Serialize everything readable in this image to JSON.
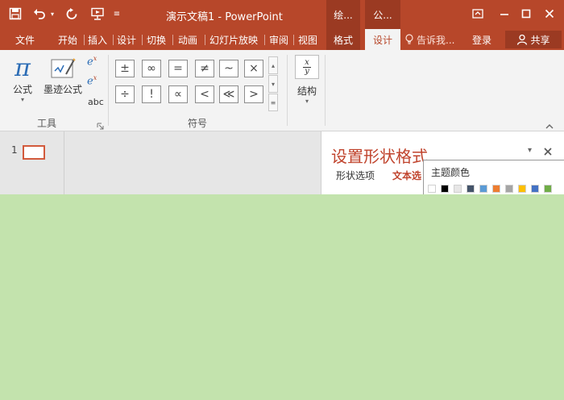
{
  "titlebar": {
    "doc_title": "演示文稿1 - PowerPoint",
    "context_tab_1": "绘...",
    "context_tab_2": "公..."
  },
  "tabs": [
    {
      "label": "文件"
    },
    {
      "label": "开始"
    },
    {
      "label": "插入"
    },
    {
      "label": "设计"
    },
    {
      "label": "切换"
    },
    {
      "label": "动画"
    },
    {
      "label": "幻灯片放映"
    },
    {
      "label": "审阅"
    },
    {
      "label": "视图"
    },
    {
      "label": "格式"
    },
    {
      "label": "设计"
    }
  ],
  "tell_me": "告诉我...",
  "sign_in": "登录",
  "share": "共享",
  "ribbon": {
    "equation_label": "公式",
    "ink_equation_label": "墨迹公式",
    "abc_label": "abc",
    "tools_group": "工具",
    "symbols_group": "符号",
    "structures_label": "结构",
    "symbols_row1": [
      "±",
      "∞",
      "=",
      "≠",
      "~",
      "×"
    ],
    "symbols_row2": [
      "÷",
      "!",
      "∝",
      "<",
      "≪",
      ">"
    ]
  },
  "slides": {
    "number": "1"
  },
  "format_pane": {
    "title": "设置形状格式",
    "tab_shape": "形状选项",
    "tab_text": "文本选"
  },
  "color_popup": {
    "title": "主题颜色",
    "swatches": [
      "#ffffff",
      "#000000",
      "#e7e6e6",
      "#44546a",
      "#5b9bd5",
      "#ed7d31",
      "#a5a5a5",
      "#ffc000",
      "#4472c4",
      "#70ad47"
    ]
  },
  "colors": {
    "accent": "#b7472a",
    "context_accent": "#9b3a22",
    "canvas_green": "#c3e3ad"
  }
}
